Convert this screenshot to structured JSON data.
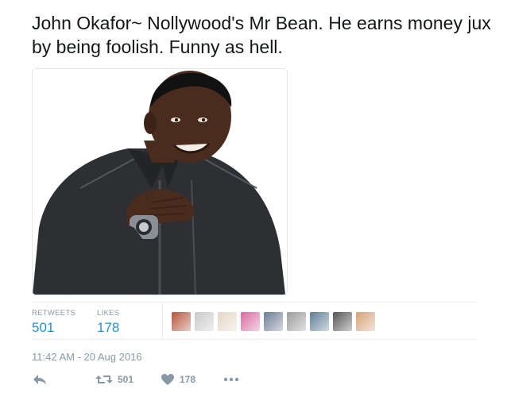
{
  "tweet": {
    "text": "John Okafor~ Nollywood's Mr Bean. He earns money jux by being foolish. Funny as hell."
  },
  "media": {
    "alt": "photo of a smiling man in a dark shirt with hand on chest",
    "colors": {
      "shirt": "#2e2f33",
      "skin": "#4a2c1e",
      "hair": "#111111",
      "watch": "#8a8f96"
    }
  },
  "stats": {
    "retweets_label": "RETWEETS",
    "retweets_value": "501",
    "likes_label": "LIKES",
    "likes_value": "178",
    "avatar_colors": [
      "#b5553c",
      "#c9c9c9",
      "#e5d6c6",
      "#d96aa2",
      "#6d7c96",
      "#9b9b9b",
      "#5f7f97",
      "#555555",
      "#d6a37a"
    ]
  },
  "timestamp": "11:42 AM - 20 Aug 2016",
  "actions": {
    "reply_icon": "reply-icon",
    "retweet_icon": "retweet-icon",
    "retweet_count": "501",
    "like_icon": "heart-icon",
    "like_count": "178",
    "more_icon": "more-icon"
  },
  "colors": {
    "text": "#14171a",
    "muted": "#8899a6",
    "link": "#1b95e0",
    "border": "#e6ecf0"
  }
}
